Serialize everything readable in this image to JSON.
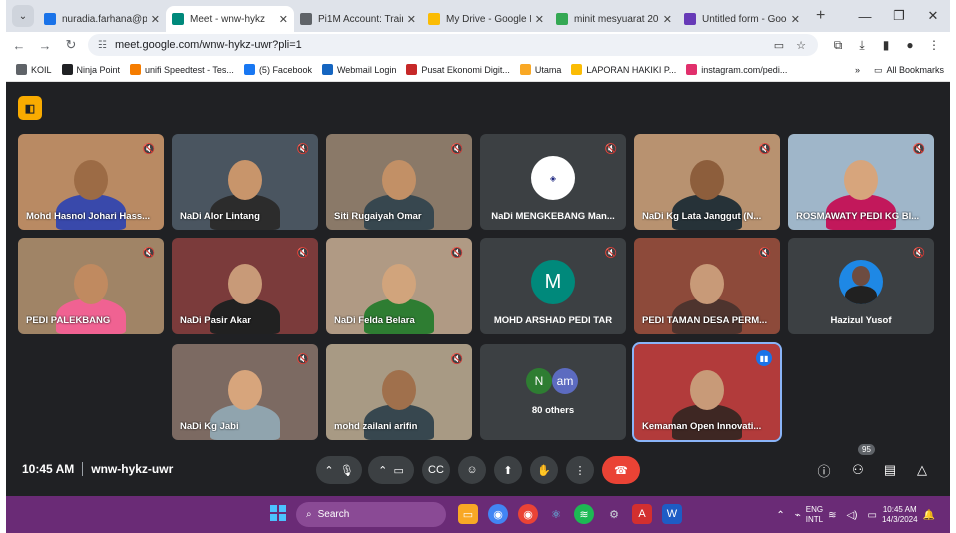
{
  "browser": {
    "tabs": [
      {
        "title": "nuradia.farhana@pe",
        "favicon_color": "#1a73e8",
        "active": false
      },
      {
        "title": "Meet - wnw-hykz",
        "favicon_color": "#00897b",
        "active": true
      },
      {
        "title": "Pi1M Account: Trainin",
        "favicon_color": "#5f6368",
        "active": false
      },
      {
        "title": "My Drive - Google D",
        "favicon_color": "#fbbc04",
        "active": false
      },
      {
        "title": "minit mesyuarat 2024",
        "favicon_color": "#34a853",
        "active": false
      },
      {
        "title": "Untitled form - Goog",
        "favicon_color": "#673ab7",
        "active": false
      }
    ],
    "tab_close": "✕",
    "new_tab": "+",
    "url": "meet.google.com/wnw-hykz-uwr?pli=1",
    "bookmarks": [
      {
        "label": "KOIL",
        "color": "#5f6368"
      },
      {
        "label": "Ninja Point",
        "color": "#202124"
      },
      {
        "label": "unifi Speedtest - Tes...",
        "color": "#f57c00"
      },
      {
        "label": "(5) Facebook",
        "color": "#1877f2"
      },
      {
        "label": "Webmail Login",
        "color": "#1565c0"
      },
      {
        "label": "Pusat Ekonomi Digit...",
        "color": "#c62828"
      },
      {
        "label": "Utama",
        "color": "#f9a825"
      },
      {
        "label": "LAPORAN HAKIKI P...",
        "color": "#fbbc04"
      },
      {
        "label": "instagram.com/pedi...",
        "color": "#e1306c"
      }
    ],
    "bookmarks_more": "»",
    "all_bookmarks": "All Bookmarks"
  },
  "meet": {
    "participants": [
      {
        "name": "Mohd Hasnol Johari Hass...",
        "bg": "#b98a63",
        "skin": "#9c6b45",
        "shirt": "#3949ab"
      },
      {
        "name": "NaDi Alor Lintang",
        "bg": "#4a5560",
        "skin": "#c8956b",
        "shirt": "#2c2c2c"
      },
      {
        "name": "Siti Rugaiyah Omar",
        "bg": "#8a7968",
        "skin": "#c29066",
        "shirt": "#37474f"
      },
      {
        "name": "NaDi MENGKEBANG Man...",
        "bg": "#3c4043",
        "logo": true
      },
      {
        "name": "NaDi Kg Lata Janggut (N...",
        "bg": "#b89270",
        "skin": "#8d5e3c",
        "shirt": "#263238"
      },
      {
        "name": "ROSMAWATY PEDI KG BI...",
        "bg": "#9fb6c9",
        "skin": "#d7a57c",
        "shirt": "#c2185b"
      },
      {
        "name": "PEDI PALEKBANG",
        "bg": "#a08466",
        "skin": "#c08a60",
        "shirt": "#f06292"
      },
      {
        "name": "NaDi Pasir Akar",
        "bg": "#7b3b3b",
        "skin": "#c89a78",
        "shirt": "#212121"
      },
      {
        "name": "NaDi Felda Belara",
        "bg": "#b09a84",
        "skin": "#d1a47c",
        "shirt": "#2e7d32"
      },
      {
        "name": "MOHD ARSHAD PEDI TAR",
        "bg": "#3c4043",
        "initial": "M",
        "avatar_color": "#00897b"
      },
      {
        "name": "PEDI TAMAN DESA PERM...",
        "bg": "#8d4a3a",
        "skin": "#c89a78",
        "shirt": "#4e342e"
      },
      {
        "name": "Hazizul Yusof",
        "bg": "#3c4043",
        "photo_avatar": true
      },
      {
        "name": "NaDi Kg Jabi",
        "bg": "#7c6a62",
        "skin": "#d7a57c",
        "shirt": "#90a4ae"
      },
      {
        "name": "mohd zailani arifin",
        "bg": "#a89a84",
        "skin": "#a0704c",
        "shirt": "#37474f"
      },
      {
        "name": "80 others",
        "bg": "#3c4043",
        "others": true,
        "initials": [
          "N",
          "am"
        ],
        "initial_colors": [
          "#2e7d32",
          "#5c6bc0"
        ]
      },
      {
        "name": "Kemaman Open Innovati...",
        "bg": "#b23b3b",
        "skin": "#c89a78",
        "shirt": "#3e2723",
        "speaking": true
      }
    ],
    "time": "10:45 AM",
    "meeting_code": "wnw-hykz-uwr",
    "participant_count": "95"
  },
  "taskbar": {
    "search_placeholder": "Search",
    "lang_line1": "ENG",
    "lang_line2": "INTL",
    "clock_time": "10:45 AM",
    "clock_date": "14/3/2024"
  }
}
